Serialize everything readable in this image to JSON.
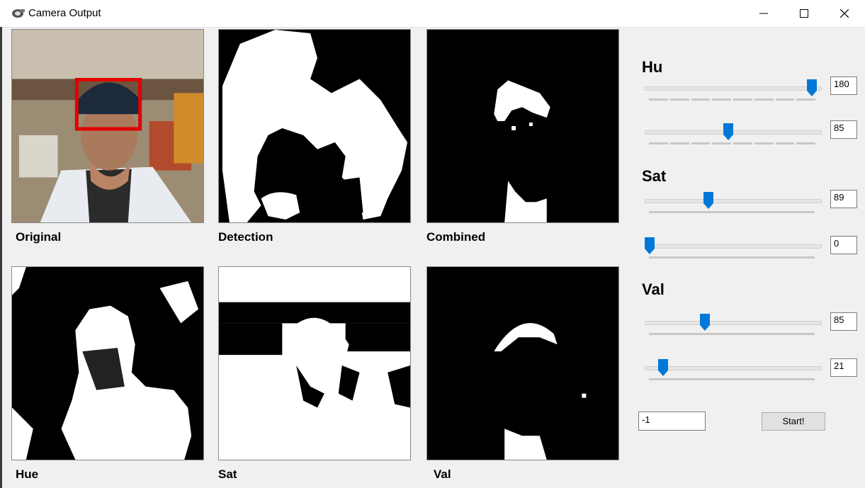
{
  "window": {
    "title": "Camera Output"
  },
  "panels": {
    "original": "Original",
    "detection": "Detection",
    "combined": "Combined",
    "hue": "Hue",
    "sat": "Sat",
    "val": "Val"
  },
  "controls": {
    "hu_label": "Hu",
    "sat_label": "Sat",
    "val_label": "Val",
    "sliders": [
      {
        "id": "hu_max",
        "value": "180",
        "fraction": 0.97,
        "ticks": true
      },
      {
        "id": "hu_min",
        "value": "85",
        "fraction": 0.47,
        "ticks": true
      },
      {
        "id": "sat_max",
        "value": "89",
        "fraction": 0.35,
        "ticks": false
      },
      {
        "id": "sat_min",
        "value": "0",
        "fraction": 0.0,
        "ticks": false
      },
      {
        "id": "val_max",
        "value": "85",
        "fraction": 0.33,
        "ticks": false
      },
      {
        "id": "val_min",
        "value": "21",
        "fraction": 0.08,
        "ticks": false
      }
    ],
    "output_value": "-1",
    "start_label": "Start!"
  },
  "colors": {
    "slider_thumb": "#0078d7",
    "detection_box": "#e00000"
  }
}
